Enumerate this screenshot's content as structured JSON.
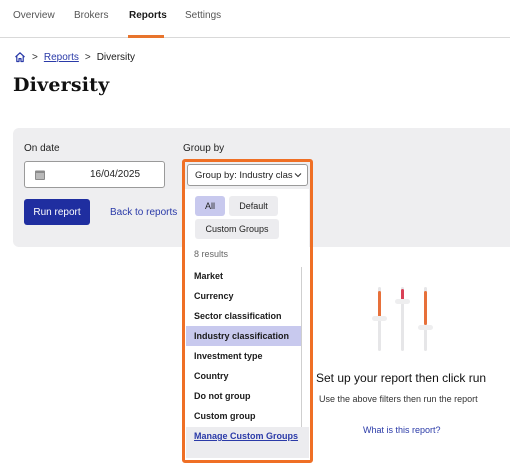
{
  "nav": {
    "tabs": [
      {
        "label": "Overview"
      },
      {
        "label": "Brokers"
      },
      {
        "label": "Reports"
      },
      {
        "label": "Settings"
      }
    ],
    "active_tab": "Reports",
    "accent_color": "#e8742c"
  },
  "breadcrumb": {
    "home_icon": "home-icon",
    "items": [
      {
        "label": "Reports",
        "link": true
      },
      {
        "label": "Diversity",
        "link": false
      }
    ]
  },
  "page": {
    "title": "Diversity"
  },
  "filters": {
    "on_date": {
      "label": "On date",
      "value": "16/04/2025",
      "icon": "calendar-icon"
    },
    "group_by": {
      "label": "Group by",
      "value": "Group by: Industry classification",
      "icon": "chevron-down-icon",
      "pills": [
        {
          "label": "All",
          "active": true
        },
        {
          "label": "Default",
          "active": false
        },
        {
          "label": "Custom Groups",
          "active": false
        }
      ],
      "results_text": "8 results",
      "options": [
        {
          "label": "Market",
          "selected": false
        },
        {
          "label": "Currency",
          "selected": false
        },
        {
          "label": "Sector classification",
          "selected": false
        },
        {
          "label": "Industry classification",
          "selected": true
        },
        {
          "label": "Investment type",
          "selected": false
        },
        {
          "label": "Country",
          "selected": false
        },
        {
          "label": "Do not group",
          "selected": false
        },
        {
          "label": "Custom group",
          "selected": false
        }
      ],
      "manage_link": "Manage Custom Groups",
      "highlight_color": "#ef6f25"
    },
    "run_button": "Run report",
    "back_link": "Back to reports",
    "primary_color": "#1f2ea0"
  },
  "empty_state": {
    "icon": "sliders-icon",
    "title": "Set up your report then click run",
    "subtitle": "Use the above filters then run the report",
    "link": "What is this report?"
  }
}
